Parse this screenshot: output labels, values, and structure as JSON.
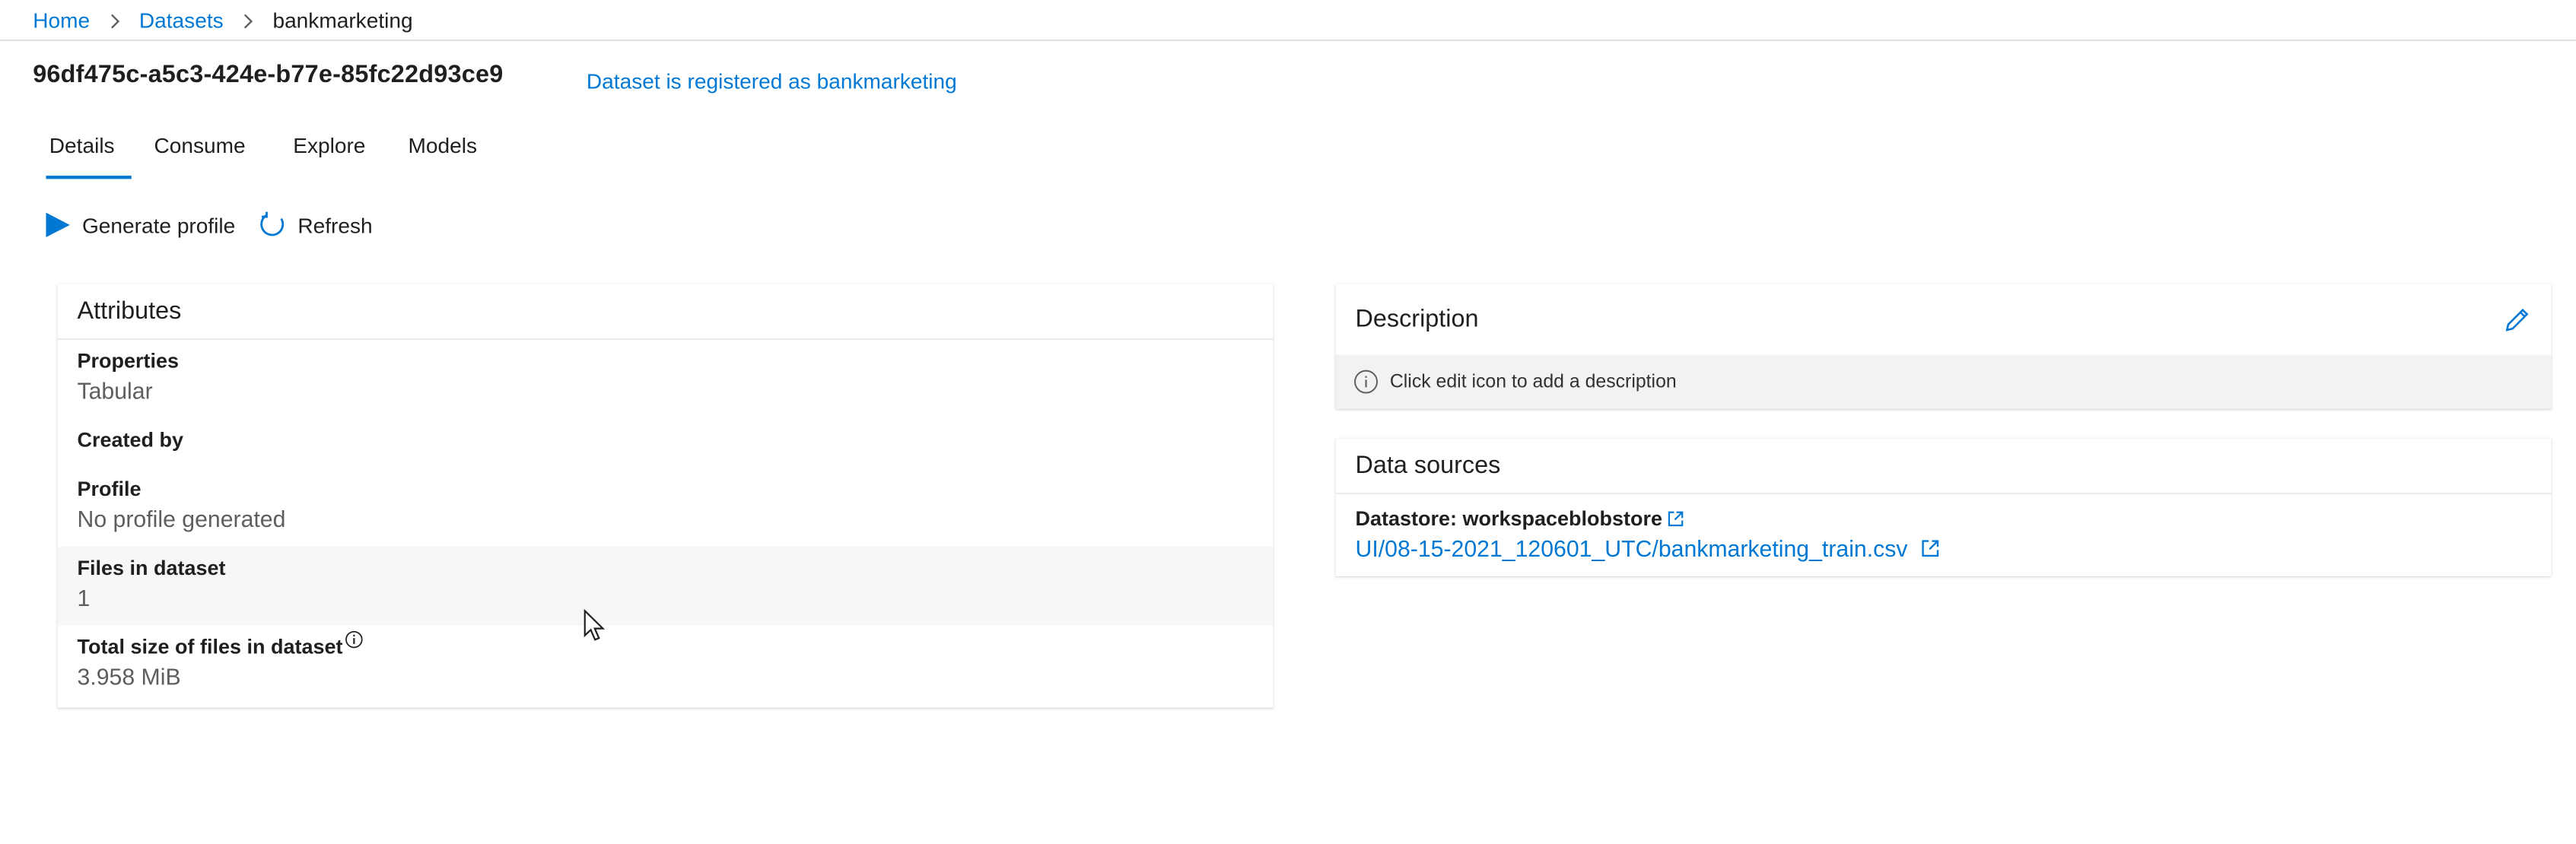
{
  "breadcrumb": {
    "items": [
      {
        "label": "Home"
      },
      {
        "label": "Datasets"
      },
      {
        "label": "bankmarketing"
      }
    ]
  },
  "header": {
    "title": "96df475c-a5c3-424e-b77e-85fc22d93ce9",
    "registered_text": "Dataset is registered as bankmarketing"
  },
  "tabs": [
    {
      "label": "Details",
      "active": true
    },
    {
      "label": "Consume",
      "active": false
    },
    {
      "label": "Explore",
      "active": false
    },
    {
      "label": "Models",
      "active": false
    }
  ],
  "toolbar": {
    "generate_profile_label": "Generate profile",
    "refresh_label": "Refresh"
  },
  "attributes": {
    "title": "Attributes",
    "items": [
      {
        "label": "Properties",
        "value": "Tabular"
      },
      {
        "label": "Created by",
        "value": ""
      },
      {
        "label": "Profile",
        "value": "No profile generated"
      },
      {
        "label": "Files in dataset",
        "value": "1"
      },
      {
        "label": "Total size of files in dataset",
        "value": "3.958 MiB"
      }
    ]
  },
  "description": {
    "title": "Description",
    "hint": "Click edit icon to add a description"
  },
  "data_sources": {
    "title": "Data sources",
    "datastore_label": "Datastore: workspaceblobstore",
    "path": "UI/08-15-2021_120601_UTC/bankmarketing_train.csv"
  },
  "colors": {
    "accent": "#0078d4",
    "text": "#201f1e",
    "muted": "#605e5c"
  }
}
